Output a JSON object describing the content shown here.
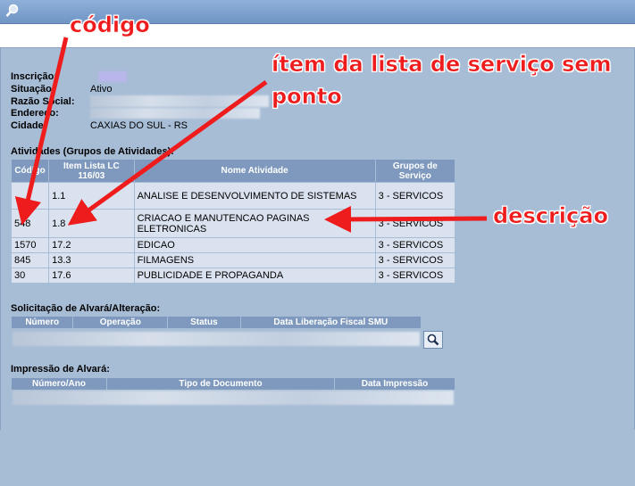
{
  "info": {
    "inscricao_label": "Inscrição:",
    "situacao_label": "Situação:",
    "situacao_value": "Ativo",
    "razao_label": "Razão Social:",
    "endereco_label": "Endereço:",
    "cidade_label": "Cidade:",
    "cidade_value": "CAXIAS DO SUL - RS"
  },
  "atividades": {
    "title": "Atividades (Grupos de Atividades):",
    "headers": [
      "Código",
      "Item Lista LC 116/03",
      "Nome Atividade",
      "Grupos de Serviço"
    ],
    "rows": [
      {
        "codigo": "",
        "item": "1.1",
        "nome": "ANALISE E DESENVOLVIMENTO DE SISTEMAS",
        "grupo": "3 - SERVICOS"
      },
      {
        "codigo": "548",
        "item": "1.8",
        "nome": "CRIACAO E MANUTENCAO PAGINAS ELETRONICAS",
        "grupo": "3 - SERVICOS"
      },
      {
        "codigo": "1570",
        "item": "17.2",
        "nome": "EDICAO",
        "grupo": "3 - SERVICOS"
      },
      {
        "codigo": "845",
        "item": "13.3",
        "nome": "FILMAGENS",
        "grupo": "3 - SERVICOS"
      },
      {
        "codigo": "30",
        "item": "17.6",
        "nome": "PUBLICIDADE E PROPAGANDA",
        "grupo": "3 - SERVICOS"
      }
    ]
  },
  "solicitacao": {
    "title": "Solicitação de Alvará/Alteração:",
    "headers": [
      "Número",
      "Operação",
      "Status",
      "Data Liberação Fiscal SMU"
    ]
  },
  "impressao": {
    "title": "Impressão de Alvará:",
    "headers": [
      "Número/Ano",
      "Tipo de Documento",
      "Data Impressão"
    ]
  },
  "annotations": {
    "codigo": "código",
    "item_lista": "ítem da lista de serviço sem",
    "item_lista_2": "ponto",
    "descricao": "descrição"
  },
  "colors": {
    "annotation": "#ee1c1c",
    "header_bg": "#7e99bd",
    "panel_bg": "#a7bdd6"
  }
}
